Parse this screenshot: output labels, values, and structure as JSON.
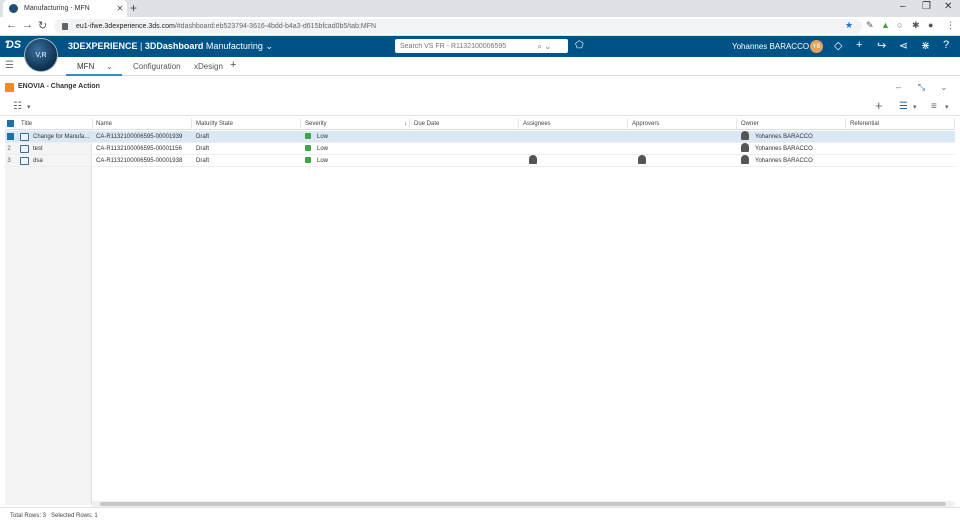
{
  "browser": {
    "tab_title": "Manufacturing - MFN",
    "new_tab": "+",
    "url_host": "eu1-ifwe.3dexperience.3ds.com",
    "url_path": "/#dashboard:eb523794-3616-4bdd-b4a3-d615bfcad0b5/tab:MFN"
  },
  "topbar": {
    "brand": "3DEXPERIENCE",
    "dashboard": "3DDashboard",
    "workspace": "Manufacturing",
    "search_placeholder": "Search VS FR - R1132100006595",
    "user_name": "Yohannes BARACCO",
    "user_initials": "YB",
    "compass_label": "V,R"
  },
  "dashboard_tabs": [
    "MFN",
    "Configuration",
    "xDesign"
  ],
  "widget": {
    "title": "ENOVIA - Change Action"
  },
  "table": {
    "columns": [
      "Title",
      "Name",
      "Maturity State",
      "Severity",
      "Due Date",
      "Assignees",
      "Approvers",
      "Owner",
      "Referential"
    ],
    "rows": [
      {
        "num": "1",
        "title": "Change for Manufa...",
        "name": "CA-R1132100006595-00001939",
        "state": "Draft",
        "severity": "Low",
        "due": "",
        "assignee": false,
        "approver": false,
        "owner": "Yohannes BARACCO",
        "selected": true
      },
      {
        "num": "2",
        "title": "test",
        "name": "CA-R1132100006595-00001156",
        "state": "Draft",
        "severity": "Low",
        "due": "",
        "assignee": false,
        "approver": false,
        "owner": "Yohannes BARACCO",
        "selected": false
      },
      {
        "num": "3",
        "title": "dsa",
        "name": "CA-R1132100006595-00001938",
        "state": "Draft",
        "severity": "Low",
        "due": "",
        "assignee": true,
        "approver": true,
        "owner": "Yohannes BARACCO",
        "selected": false
      }
    ]
  },
  "footer": {
    "total_rows": "Total Rows: 3",
    "selected_rows": "Selected Rows: 1"
  },
  "colors": {
    "topbar": "#005386",
    "accent": "#368ec4",
    "severity_low": "#3aa64a",
    "selected_row": "#d9e8f4"
  }
}
